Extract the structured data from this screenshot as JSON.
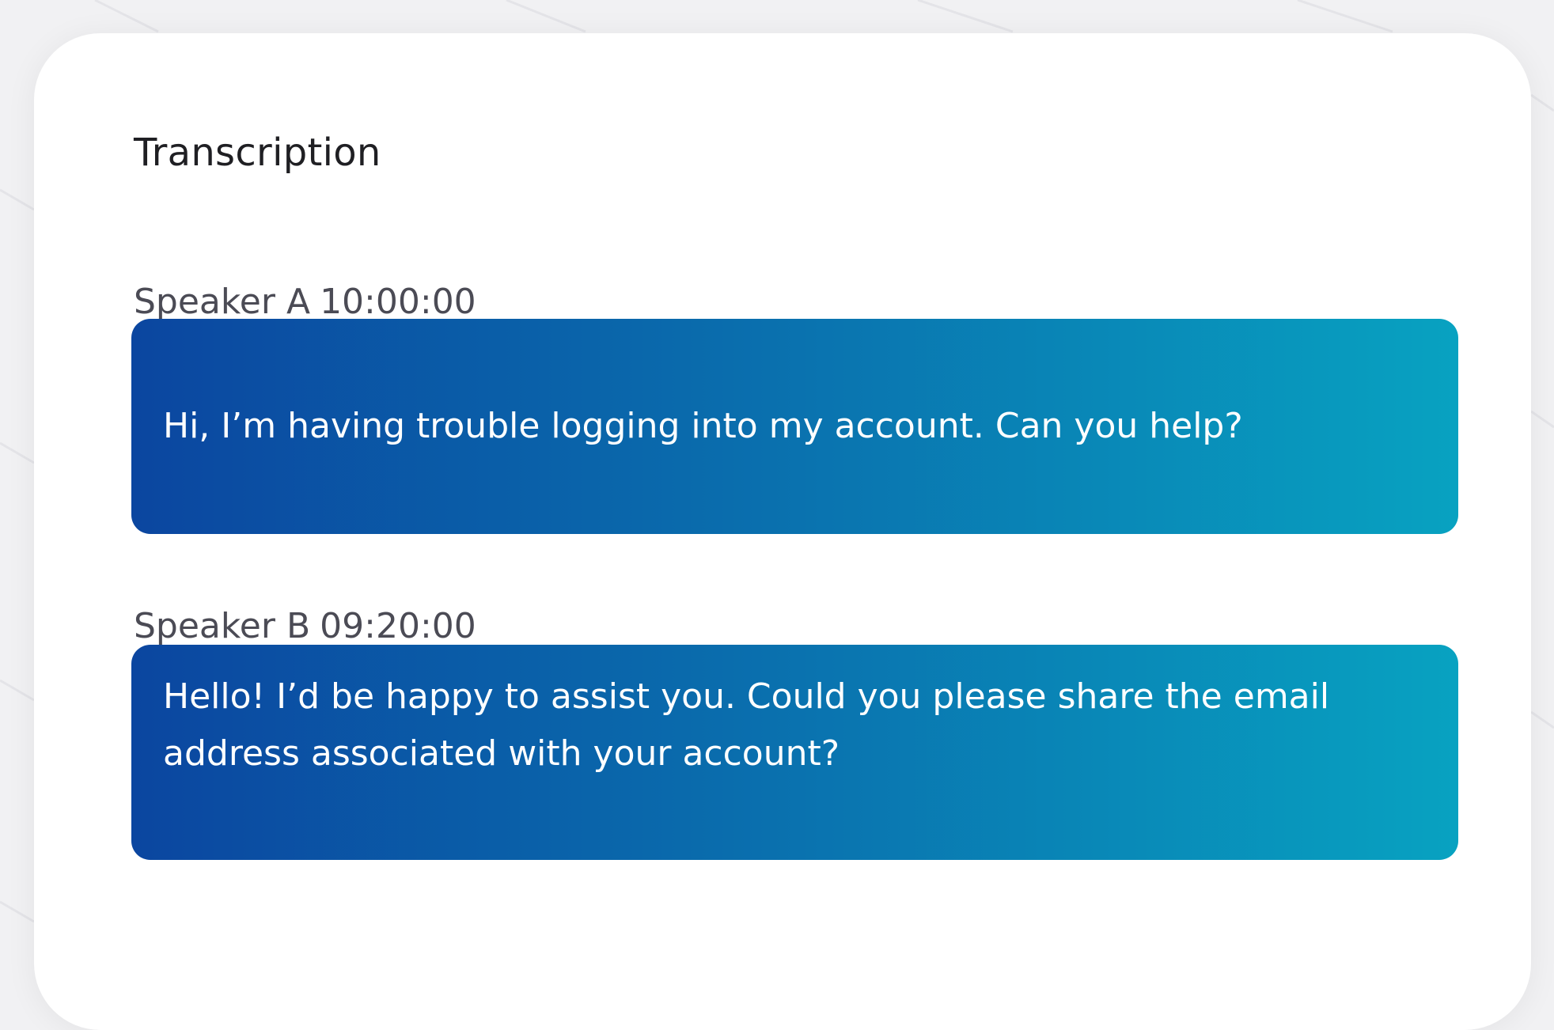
{
  "transcription": {
    "title": "Transcription",
    "messages": [
      {
        "speaker": "Speaker A",
        "time": "10:00:00",
        "text": "Hi, I’m having trouble logging into my account. Can you help?"
      },
      {
        "speaker": "Speaker B",
        "time": "09:20:00",
        "text": "Hello! I’d be happy to assist you. Could you please share the email address associated with your account?"
      }
    ]
  },
  "colors": {
    "bubble_gradient_start": "#0b46a0",
    "bubble_gradient_end": "#08a2c1",
    "card_background": "#ffffff",
    "page_background": "#f1f1f3"
  }
}
